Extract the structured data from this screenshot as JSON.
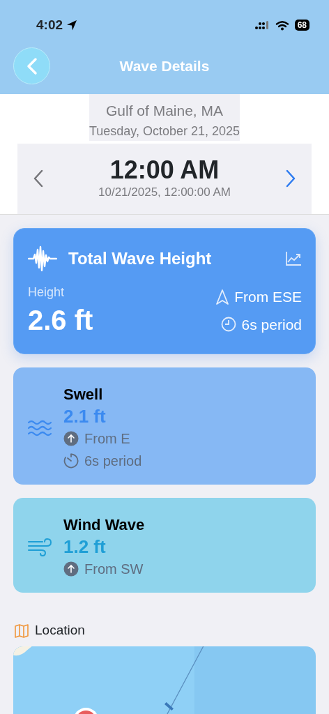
{
  "status_bar": {
    "time": "4:02",
    "battery": "68"
  },
  "nav": {
    "title": "Wave Details"
  },
  "header": {
    "location": "Gulf of Maine, MA",
    "date": "Tuesday, October 21, 2025",
    "time": "12:00 AM",
    "timestamp": "10/21/2025, 12:00:00 AM",
    "nav_buttons": [
      {
        "kind": "prev",
        "disabled": true
      },
      {
        "kind": "next",
        "disabled": false
      }
    ]
  },
  "total": {
    "title": "Total Wave Height",
    "label": "Height",
    "height": "2.6 ft",
    "direction": "From ESE",
    "period": "6s period"
  },
  "components": [
    {
      "kind": "swell",
      "title": "Swell",
      "height": "2.1 ft",
      "direction": "From E",
      "period": "6s period",
      "color": "#3b8af0"
    },
    {
      "kind": "wind",
      "title": "Wind Wave",
      "height": "1.2 ft",
      "direction": "From SW",
      "color": "#1f9fd6"
    }
  ],
  "location": {
    "title": "Location"
  }
}
